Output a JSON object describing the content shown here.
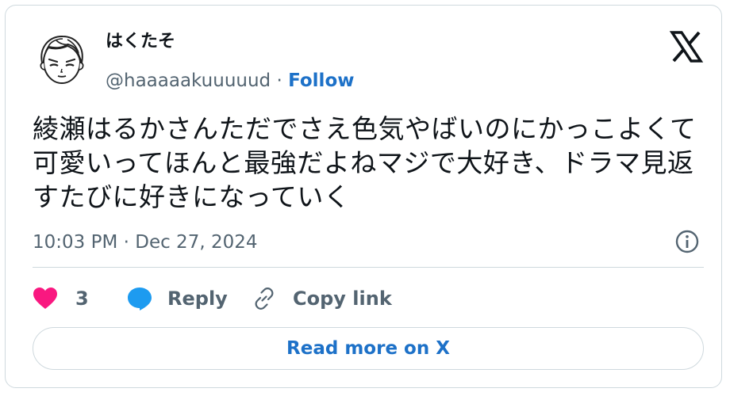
{
  "author": {
    "display_name": "はくたそ",
    "handle": "@haaaaakuuuuud",
    "separator": "·",
    "follow_label": "Follow"
  },
  "tweet": {
    "text": "綾瀬はるかさんただでさえ色気やばいのにかっこよくて可愛いってほんと最強だよねマジで大好き、ドラマ見返すたびに好きになっていく",
    "timestamp": "10:03 PM · Dec 27, 2024"
  },
  "actions": {
    "like_count": "3",
    "reply_label": "Reply",
    "copy_link_label": "Copy link"
  },
  "read_more_label": "Read more on X",
  "colors": {
    "like": "#f91880",
    "reply_icon": "#1d9bf0",
    "link": "#1d71c8",
    "muted": "#536471"
  }
}
